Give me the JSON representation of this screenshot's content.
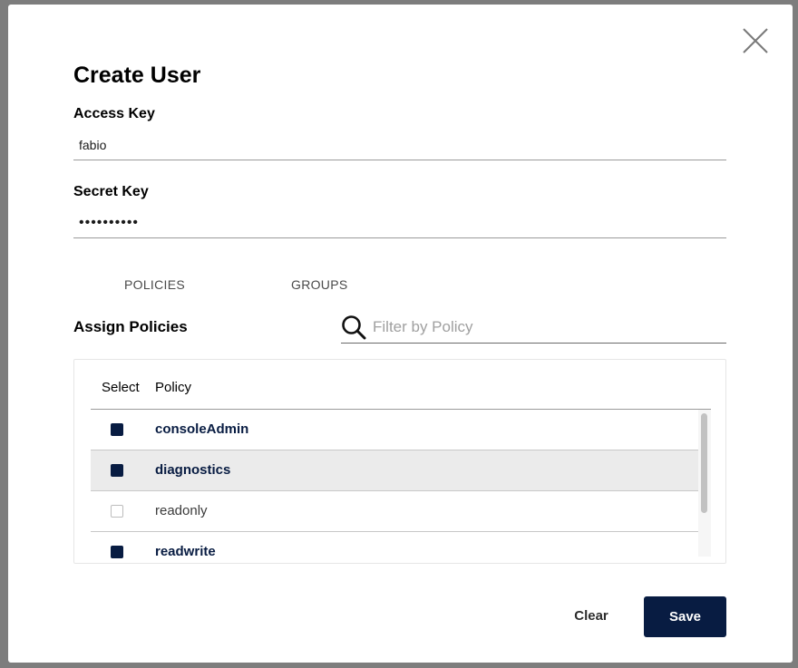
{
  "dialog": {
    "title": "Create User",
    "close_icon": "close-icon"
  },
  "form": {
    "access_key": {
      "label": "Access Key",
      "value": "fabio"
    },
    "secret_key": {
      "label": "Secret Key",
      "value": "••••••••••"
    }
  },
  "tabs": [
    {
      "label": "POLICIES"
    },
    {
      "label": "GROUPS"
    }
  ],
  "policies": {
    "section_label": "Assign Policies",
    "filter": {
      "placeholder": "Filter by Policy",
      "icon": "search-icon"
    },
    "columns": {
      "select": "Select",
      "policy": "Policy"
    },
    "rows": [
      {
        "name": "consoleAdmin",
        "checked": true
      },
      {
        "name": "diagnostics",
        "checked": true
      },
      {
        "name": "readonly",
        "checked": false
      },
      {
        "name": "readwrite",
        "checked": true
      }
    ]
  },
  "actions": {
    "clear_label": "Clear",
    "save_label": "Save"
  },
  "colors": {
    "primary": "#081c42",
    "overlay": "#7d7d7d",
    "row_highlight": "#ebebeb"
  }
}
